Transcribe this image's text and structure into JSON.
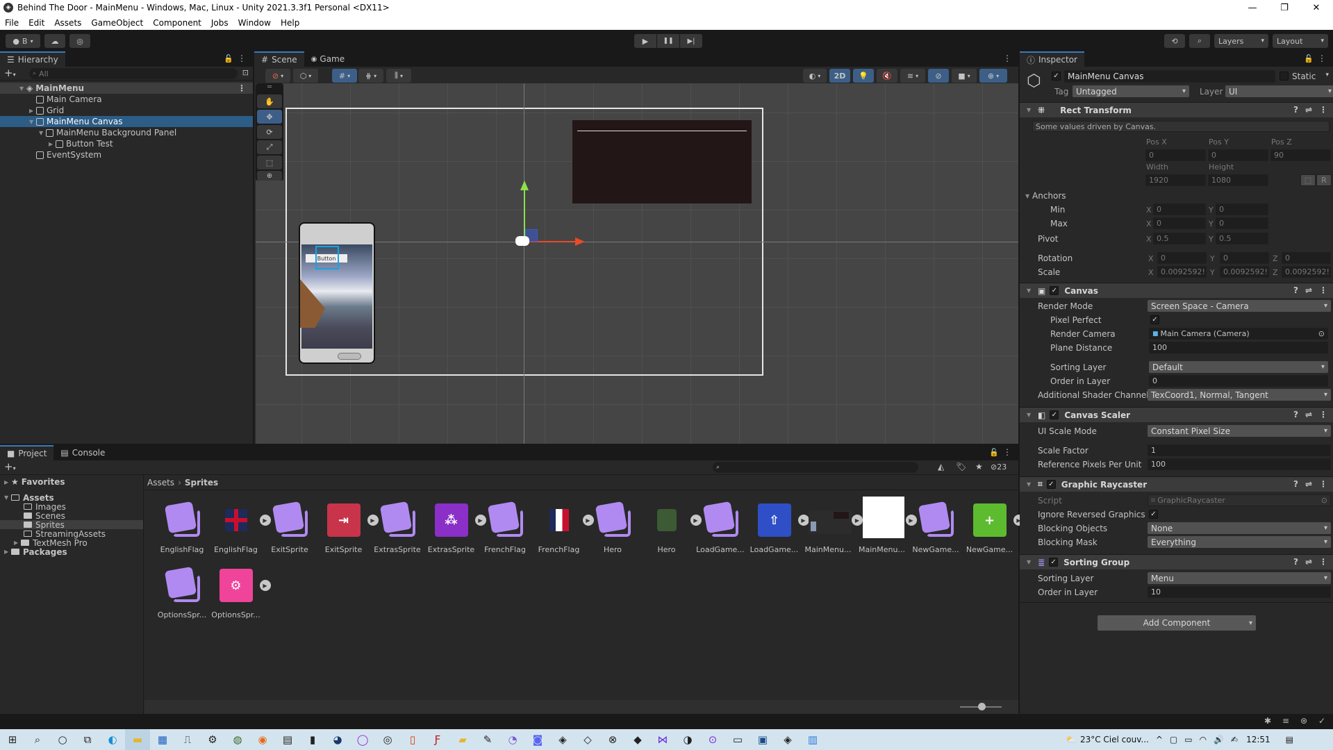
{
  "window": {
    "title": "Behind The Door - MainMenu - Windows, Mac, Linux - Unity 2021.3.3f1 Personal <DX11>",
    "controls": {
      "minimize": "—",
      "maximize": "❐",
      "close": "✕"
    }
  },
  "menu": [
    "File",
    "Edit",
    "Assets",
    "GameObject",
    "Component",
    "Jobs",
    "Window",
    "Help"
  ],
  "toolbar": {
    "account_label": "B",
    "play_icon": "▶",
    "pause_icon": "❚❚",
    "step_icon": "▶|",
    "history_icon": "⟲",
    "search_icon": "⌕",
    "layers_label": "Layers",
    "layout_label": "Layout"
  },
  "hierarchy": {
    "tab_label": "Hierarchy",
    "search_placeholder": "All",
    "items": [
      {
        "label": "MainMenu",
        "depth": 0,
        "type": "scene",
        "expanded": true
      },
      {
        "label": "Main Camera",
        "depth": 1,
        "type": "object"
      },
      {
        "label": "Grid",
        "depth": 1,
        "type": "object",
        "collapsed": true
      },
      {
        "label": "MainMenu Canvas",
        "depth": 1,
        "type": "object",
        "expanded": true,
        "selected": true
      },
      {
        "label": "MainMenu Background Panel",
        "depth": 2,
        "type": "object",
        "expanded": true
      },
      {
        "label": "Button Test",
        "depth": 3,
        "type": "object",
        "collapsed": true
      },
      {
        "label": "EventSystem",
        "depth": 1,
        "type": "object"
      }
    ]
  },
  "scene_view": {
    "tabs": [
      {
        "label": "Scene",
        "icon": "#",
        "active": true
      },
      {
        "label": "Game",
        "icon": "🎮",
        "active": false
      }
    ],
    "toggle_2d": "2D",
    "tools": [
      "hand",
      "move",
      "rotate",
      "scale",
      "rect",
      "transform"
    ],
    "phone_button_text": "Button"
  },
  "project": {
    "tabs": [
      {
        "label": "Project",
        "active": true
      },
      {
        "label": "Console",
        "active": false
      }
    ],
    "favorites_label": "Favorites",
    "tree": [
      {
        "label": "Assets",
        "depth": 0,
        "bold": true,
        "expanded": true
      },
      {
        "label": "Images",
        "depth": 1,
        "empty": true
      },
      {
        "label": "Scenes",
        "depth": 1
      },
      {
        "label": "Sprites",
        "depth": 1,
        "selected": true
      },
      {
        "label": "StreamingAssets",
        "depth": 1,
        "empty": true
      },
      {
        "label": "TextMesh Pro",
        "depth": 1,
        "collapsed": true
      },
      {
        "label": "Packages",
        "depth": 0,
        "bold": true,
        "collapsed": true
      }
    ],
    "breadcrumb": [
      "Assets",
      "Sprites"
    ],
    "hidden_count": "23",
    "assets": [
      {
        "name": "EnglishFlag",
        "kind": "psd"
      },
      {
        "name": "EnglishFlag",
        "kind": "uk-flag"
      },
      {
        "name": "ExitSprite",
        "kind": "psd"
      },
      {
        "name": "ExitSprite",
        "kind": "exit",
        "color": "#c8344a"
      },
      {
        "name": "ExtrasSprite",
        "kind": "psd"
      },
      {
        "name": "ExtrasSprite",
        "kind": "extras",
        "color": "#8a2fc7"
      },
      {
        "name": "FrenchFlag",
        "kind": "psd"
      },
      {
        "name": "FrenchFlag",
        "kind": "fr-flag"
      },
      {
        "name": "Hero",
        "kind": "psd"
      },
      {
        "name": "Hero",
        "kind": "hero"
      },
      {
        "name": "LoadGame...",
        "kind": "psd"
      },
      {
        "name": "LoadGame...",
        "kind": "load",
        "color": "#2f4fc7"
      },
      {
        "name": "MainMenu...",
        "kind": "mainmenu"
      },
      {
        "name": "MainMenu...",
        "kind": "white"
      },
      {
        "name": "NewGame...",
        "kind": "psd"
      },
      {
        "name": "NewGame...",
        "kind": "new",
        "color": "#5dbb2f"
      },
      {
        "name": "OptionsSpr...",
        "kind": "psd"
      },
      {
        "name": "OptionsSpr...",
        "kind": "options",
        "color": "#f0449a"
      }
    ]
  },
  "inspector": {
    "tab_label": "Inspector",
    "object_name": "MainMenu Canvas",
    "active": true,
    "static_label": "Static",
    "tag_label": "Tag",
    "tag_value": "Untagged",
    "layer_label": "Layer",
    "layer_value": "UI",
    "rect_transform": {
      "title": "Rect Transform",
      "note": "Some values driven by Canvas.",
      "pos_x_label": "Pos X",
      "pos_y_label": "Pos Y",
      "pos_z_label": "Pos Z",
      "pos_x": "0",
      "pos_y": "0",
      "pos_z": "90",
      "width_label": "Width",
      "height_label": "Height",
      "width": "1920",
      "height": "1080",
      "anchors_label": "Anchors",
      "min_label": "Min",
      "max_label": "Max",
      "min_x": "0",
      "min_y": "0",
      "max_x": "0",
      "max_y": "0",
      "pivot_label": "Pivot",
      "pivot_x": "0.5",
      "pivot_y": "0.5",
      "rotation_label": "Rotation",
      "rot_x": "0",
      "rot_y": "0",
      "rot_z": "0",
      "scale_label": "Scale",
      "scale_x": "0.0092592!",
      "scale_y": "0.0092592!",
      "scale_z": "0.0092592!",
      "r_button": "R"
    },
    "canvas": {
      "title": "Canvas",
      "render_mode_label": "Render Mode",
      "render_mode": "Screen Space - Camera",
      "pixel_perfect_label": "Pixel Perfect",
      "pixel_perfect": true,
      "render_camera_label": "Render Camera",
      "render_camera": "Main Camera (Camera)",
      "plane_distance_label": "Plane Distance",
      "plane_distance": "100",
      "sorting_layer_label": "Sorting Layer",
      "sorting_layer": "Default",
      "order_label": "Order in Layer",
      "order": "0",
      "shader_channels_label": "Additional Shader Channels",
      "shader_channels": "TexCoord1, Normal, Tangent"
    },
    "canvas_scaler": {
      "title": "Canvas Scaler",
      "scale_mode_label": "UI Scale Mode",
      "scale_mode": "Constant Pixel Size",
      "scale_factor_label": "Scale Factor",
      "scale_factor": "1",
      "ref_ppu_label": "Reference Pixels Per Unit",
      "ref_ppu": "100"
    },
    "graphic_raycaster": {
      "title": "Graphic Raycaster",
      "script_label": "Script",
      "script": "GraphicRaycaster",
      "ignore_reversed_label": "Ignore Reversed Graphics",
      "ignore_reversed": true,
      "blocking_objects_label": "Blocking Objects",
      "blocking_objects": "None",
      "blocking_mask_label": "Blocking Mask",
      "blocking_mask": "Everything"
    },
    "sorting_group": {
      "title": "Sorting Group",
      "sorting_layer_label": "Sorting Layer",
      "sorting_layer": "Menu",
      "order_label": "Order in Layer",
      "order": "10"
    },
    "add_component": "Add Component"
  },
  "taskbar": {
    "weather": "23°C  Ciel couv...",
    "time": "12:51"
  }
}
